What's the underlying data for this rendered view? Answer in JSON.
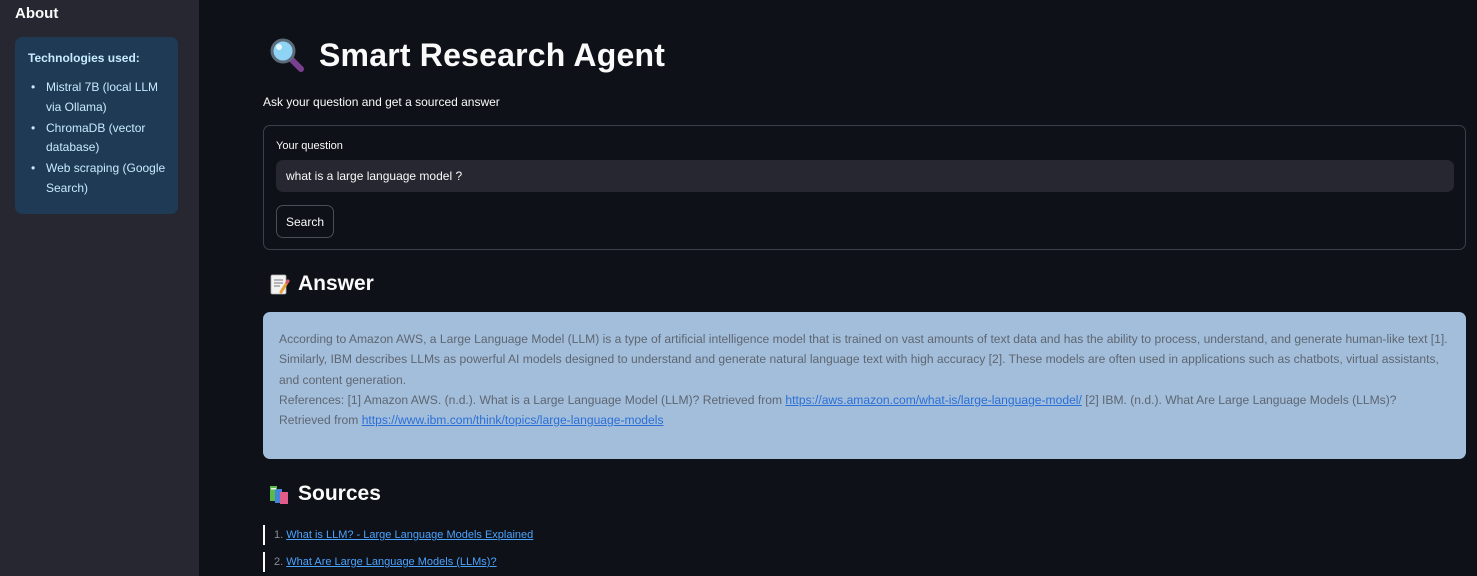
{
  "sidebar": {
    "title": "About",
    "info_heading": "Technologies used:",
    "items": [
      "Mistral 7B (local LLM via Ollama)",
      "ChromaDB (vector database)",
      "Web scraping (Google Search)"
    ]
  },
  "header": {
    "title": "Smart Research Agent",
    "title_icon": "magnifying-glass-icon",
    "subtitle": "Ask your question and get a sourced answer"
  },
  "form": {
    "label": "Your question",
    "value": "what is a large language model ?",
    "button_label": "Search"
  },
  "answer": {
    "heading": "Answer",
    "heading_icon": "memo-icon",
    "text": "According to Amazon AWS, a Large Language Model (LLM) is a type of artificial intelligence model that is trained on vast amounts of text data and has the ability to process, understand, and generate human-like text [1]. Similarly, IBM describes LLMs as powerful AI models designed to understand and generate natural language text with high accuracy [2]. These models are often used in applications such as chatbots, virtual assistants, and content generation.",
    "references_prefix": "References: [1] Amazon AWS. (n.d.). What is a Large Language Model (LLM)? Retrieved from",
    "link1": "https://aws.amazon.com/what-is/large-language-model/",
    "references_middle": "[2] IBM. (n.d.). What Are Large Language Models (LLMs)? Retrieved from",
    "link2": "https://www.ibm.com/think/topics/large-language-models"
  },
  "sources": {
    "heading": "Sources",
    "heading_icon": "books-icon",
    "items": [
      {
        "num": "1.",
        "label": "What is LLM? - Large Language Models Explained"
      },
      {
        "num": "2.",
        "label": "What Are Large Language Models (LLMs)?"
      }
    ]
  },
  "colors": {
    "background": "#0e1117",
    "sidebar": "#262730",
    "info_box": "#1f3a54",
    "answer_box": "#a3bedb",
    "link": "#4aa3ff"
  }
}
